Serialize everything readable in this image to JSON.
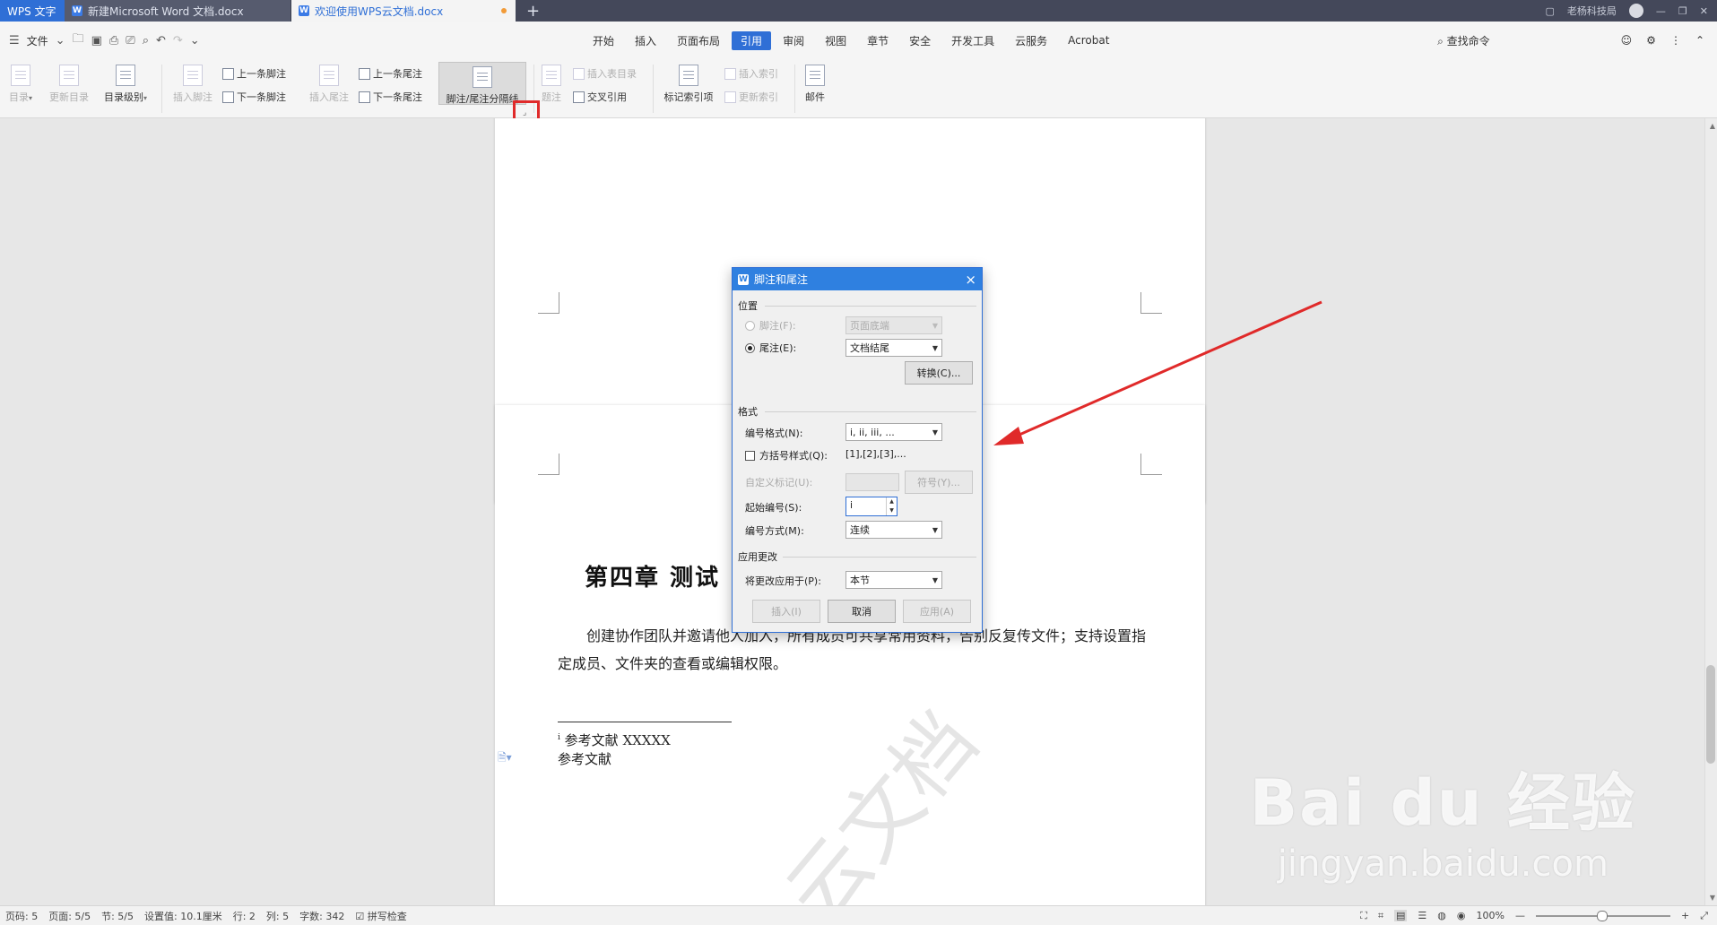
{
  "tabbar": {
    "app_label": "WPS 文字",
    "tabs": [
      {
        "label": "新建Microsoft Word 文档.docx"
      },
      {
        "label": "欢迎使用WPS云文档.docx"
      }
    ],
    "add_label": "+",
    "user_name": "老杨科技局"
  },
  "menu": {
    "file_label": "文件",
    "tabs": [
      "开始",
      "插入",
      "页面布局",
      "引用",
      "审阅",
      "视图",
      "章节",
      "安全",
      "开发工具",
      "云服务",
      "Acrobat"
    ],
    "active_tab": "引用",
    "search_label": "查找命令"
  },
  "ribbon": {
    "toc": "目录",
    "update_toc": "更新目录",
    "toc_level": "目录级别",
    "insert_footnote": "插入脚注",
    "prev_footnote": "上一条脚注",
    "next_footnote": "下一条脚注",
    "insert_endnote": "插入尾注",
    "prev_endnote": "上一条尾注",
    "next_endnote": "下一条尾注",
    "separator": "脚注/尾注分隔线",
    "caption": "题注",
    "insert_table_toc": "插入表目录",
    "cross_ref": "交叉引用",
    "mark_index": "标记索引项",
    "insert_index": "插入索引",
    "update_index": "更新索引",
    "mail": "邮件"
  },
  "document": {
    "chapter_title": "第四章  测试",
    "paragraph": "创建协作团队并邀请他人加入，所有成员可共享常用资料，告别反复传文件；支持设置指定成员、文件夹的查看或编辑权限。",
    "footnote_marker": "i",
    "footnote_text": "参考文献  XXXXX",
    "footnote_text2": "参考文献",
    "watermark": "云文档"
  },
  "dialog": {
    "title": "脚注和尾注",
    "close": "×",
    "position_section": "位置",
    "footnote_label": "脚注(F):",
    "footnote_value": "页面底端",
    "endnote_label": "尾注(E):",
    "endnote_value": "文档结尾",
    "convert_button": "转换(C)...",
    "format_section": "格式",
    "number_format_label": "编号格式(N):",
    "number_format_value": "i, ii, iii, ...",
    "bracket_label": "方括号样式(Q):",
    "bracket_sample": "[1],[2],[3],...",
    "custom_mark_label": "自定义标记(U):",
    "symbol_button": "符号(Y)...",
    "start_at_label": "起始编号(S):",
    "start_at_value": "i",
    "numbering_label": "编号方式(M):",
    "numbering_value": "连续",
    "apply_section": "应用更改",
    "apply_to_label": "将更改应用于(P):",
    "apply_to_value": "本节",
    "insert_button": "插入(I)",
    "cancel_button": "取消",
    "apply_button": "应用(A)"
  },
  "status": {
    "page_no": "页码: 5",
    "pages": "页面: 5/5",
    "section": "节: 5/5",
    "setting": "设置值: 10.1厘米",
    "row": "行: 2",
    "col": "列: 5",
    "words": "字数: 342",
    "spell": "拼写检查",
    "zoom": "100%"
  },
  "watermark_brand": {
    "logo": "Bai du 经验",
    "url": "jingyan.baidu.com"
  },
  "colors": {
    "accent": "#2f6fd6",
    "annotation_red": "#e02a2a"
  }
}
